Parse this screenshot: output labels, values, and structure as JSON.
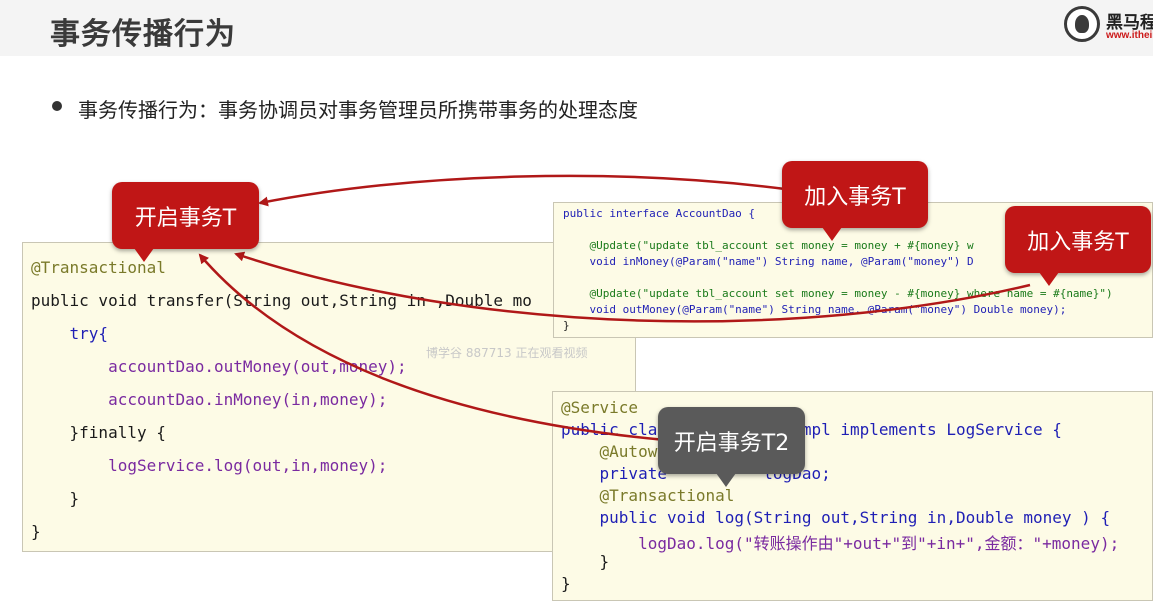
{
  "header": {
    "title": "事务传播行为",
    "logo_name": "黑马程",
    "logo_url": "www.itheim"
  },
  "bullet": {
    "text": "事务传播行为：事务协调员对事务管理员所携带事务的处理态度"
  },
  "transfer_code": [
    "@Transactional",
    "public void transfer(String out,String in ,Double mo",
    "    try{",
    "        accountDao.outMoney(out,money);",
    "        accountDao.inMoney(in,money);",
    "    }finally {",
    "        logService.log(out,in,money);",
    "    }",
    "}"
  ],
  "dao_code": [
    "public interface AccountDao {",
    "",
    "    @Update(\"update tbl_account set money = money + #{money} w",
    "    void inMoney(@Param(\"name\") String name, @Param(\"money\") D",
    "",
    "    @Update(\"update tbl_account set money = money - #{money} where name = #{name}\")",
    "    void outMoney(@Param(\"name\") String name, @Param(\"money\") Double money);",
    "}"
  ],
  "log_code": [
    "@Service",
    "public cla               mpl implements LogService {",
    "    @Autow",
    "    private          logDao;",
    "    @Transactional",
    "    public void log(String out,String in,Double money ) {",
    "        logDao.log(\"转账操作由\"+out+\"到\"+in+\",金额：\"+money);",
    "    }",
    "}"
  ],
  "watermark": "博学谷 887713 正在观看视频",
  "bubbles": {
    "open_t": "开启事务T",
    "join_t_1": "加入事务T",
    "join_t_2": "加入事务T",
    "open_t2": "开启事务T2"
  },
  "colors": {
    "bubble_red": "#c01616",
    "bubble_gray": "#5a5a5a",
    "arrow": "#b01818",
    "code_bg": "#fdfbe6"
  }
}
